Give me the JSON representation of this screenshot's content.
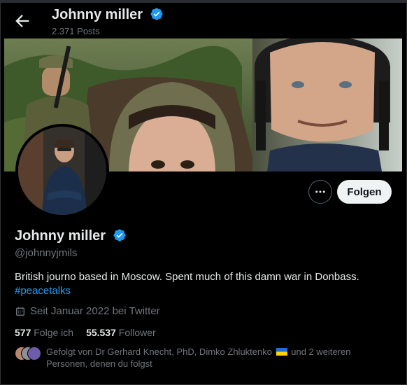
{
  "header": {
    "title": "Johnny miller",
    "posts_count": "2.371 Posts"
  },
  "profile": {
    "name": "Johnny miller",
    "handle": "@johnnyjmils",
    "bio_text": "British journo based in Moscow. Spent much of this damn war in Donbass.",
    "bio_hashtag": "#peacetalks",
    "joined": "Seit Januar 2022 bei Twitter",
    "following_count": "577",
    "following_label": "Folge ich",
    "followers_count": "55.537",
    "followers_label": "Follower",
    "followed_by_prefix": "Gefolgt von Dr Gerhard Knecht, PhD, Dimko Zhluktenko",
    "followed_by_suffix": "und 2 weiteren Personen, denen du folgst"
  },
  "actions": {
    "follow_label": "Folgen"
  },
  "icons": {
    "back": "back-arrow-icon",
    "verified": "verified-badge-icon",
    "more": "more-options-icon",
    "calendar": "calendar-icon",
    "flag": "ukraine-flag-icon"
  },
  "colors": {
    "background": "#000000",
    "accent": "#1d9bf0",
    "text_primary": "#e7e9ea",
    "text_secondary": "#71767b",
    "follow_button_bg": "#eff3f4"
  }
}
